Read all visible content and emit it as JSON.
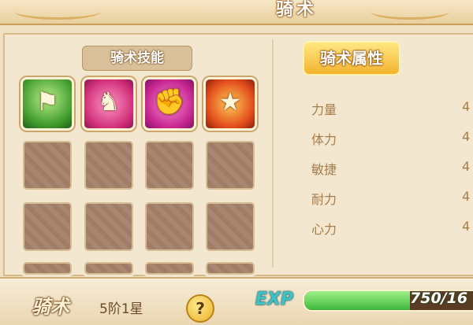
{
  "header": {
    "title": "骑术"
  },
  "skills": {
    "title": "骑术技能",
    "slots": [
      {
        "icon": "flag-icon",
        "glyph": "⚑",
        "style": "s1"
      },
      {
        "icon": "horse-icon",
        "glyph": "♞",
        "style": "s2"
      },
      {
        "icon": "fist-icon",
        "glyph": "✊",
        "style": "s3"
      },
      {
        "icon": "shield-star-icon",
        "glyph": "★",
        "style": "s4"
      }
    ]
  },
  "attributes": {
    "title": "骑术属性",
    "rows": [
      {
        "label": "力量",
        "value": "4"
      },
      {
        "label": "体力",
        "value": "4"
      },
      {
        "label": "敏捷",
        "value": "4"
      },
      {
        "label": "耐力",
        "value": "4"
      },
      {
        "label": "心力",
        "value": "4"
      }
    ]
  },
  "footer": {
    "name": "骑术",
    "level": "5阶1星",
    "help": "?",
    "exp_label": "EXP",
    "exp_text": "750/16",
    "exp_fraction": 0.62
  }
}
